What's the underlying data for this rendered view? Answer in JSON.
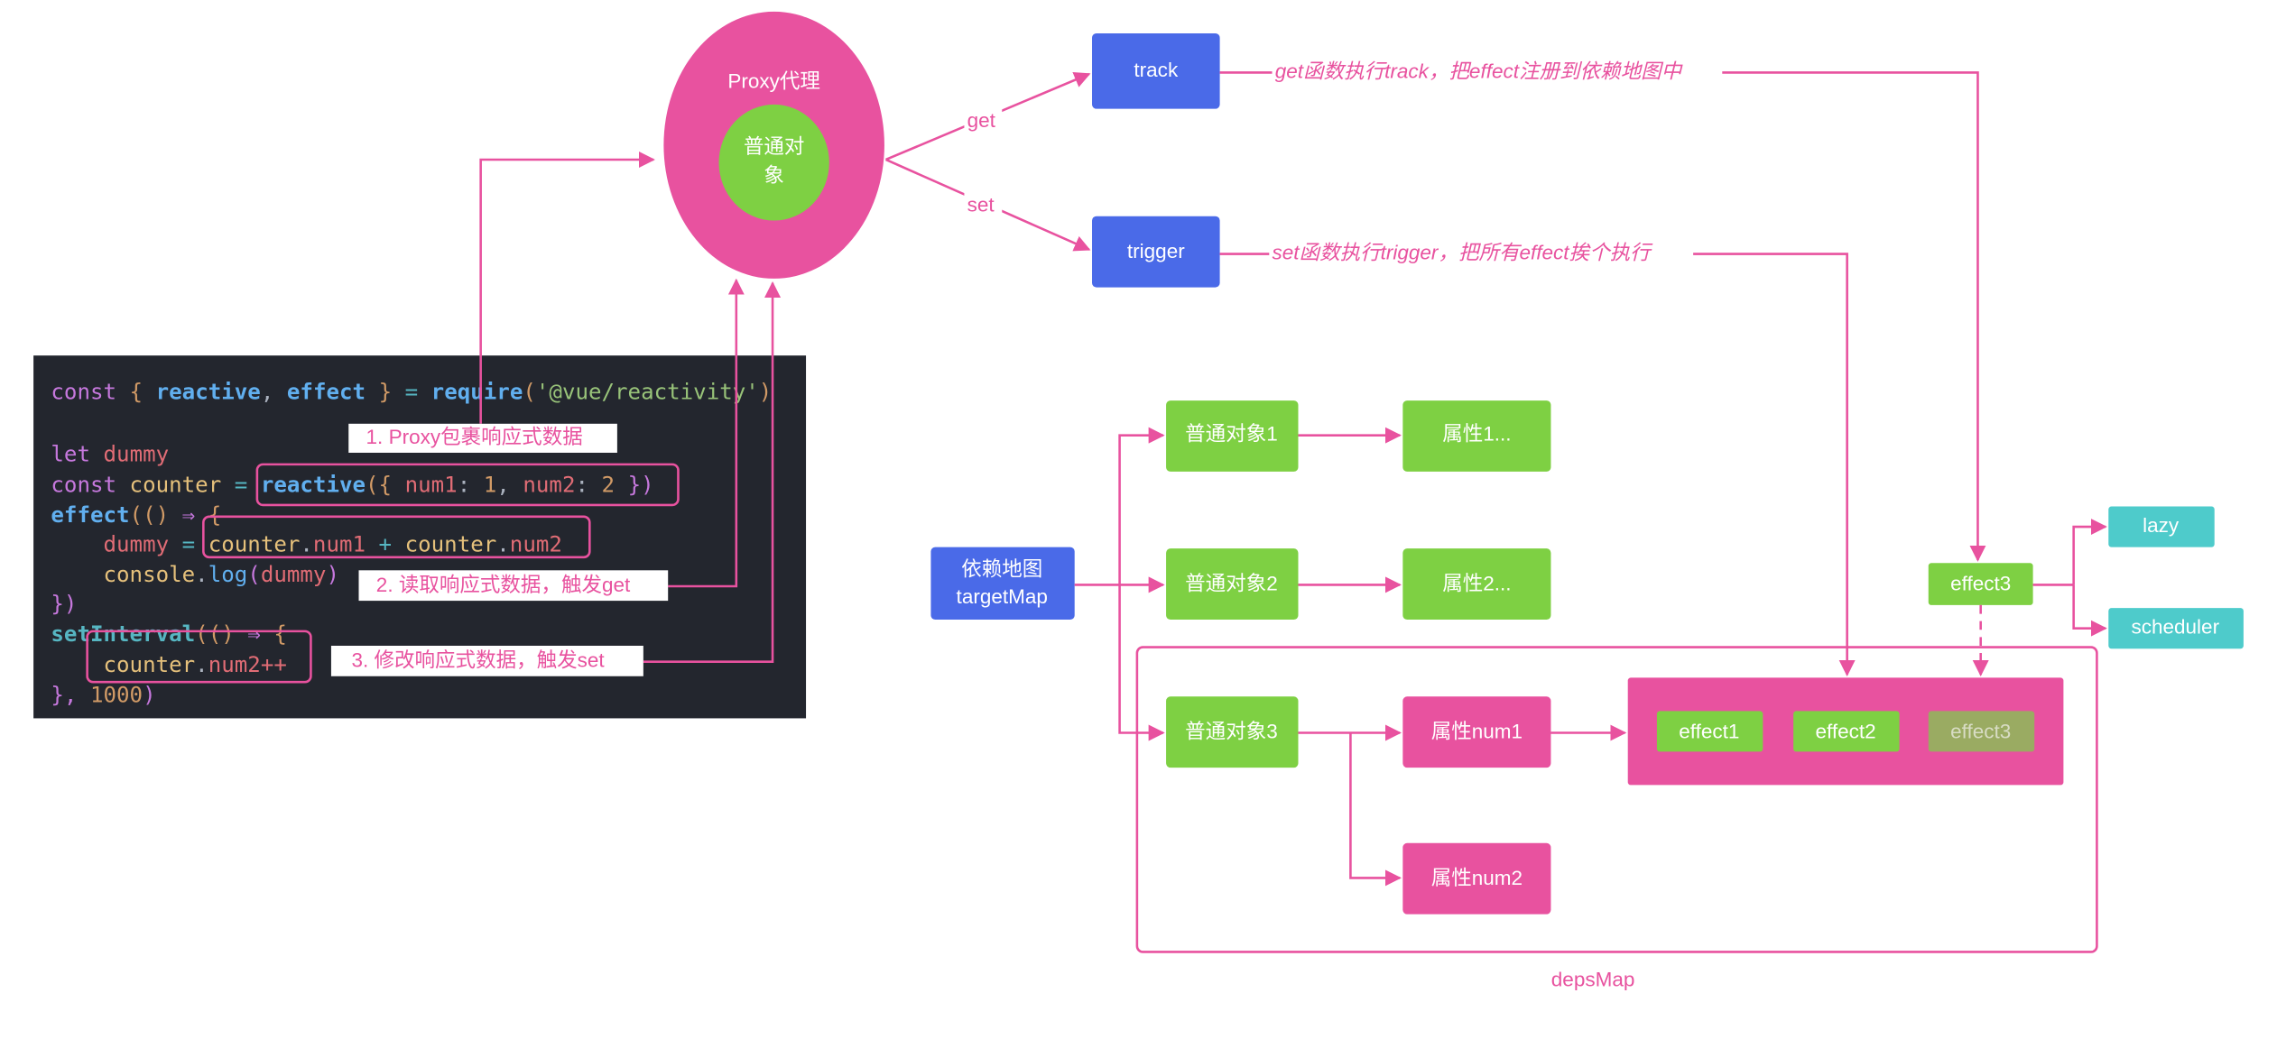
{
  "colors": {
    "pink": "#e8529f",
    "green": "#7ed043",
    "blue": "#4a6ae8",
    "teal": "#4ecbcb",
    "faded_green": "#9aab62",
    "code_bg": "#23262e"
  },
  "proxy": {
    "label": "Proxy代理",
    "inner_line1": "普通对",
    "inner_line2": "象",
    "get_label": "get",
    "set_label": "set"
  },
  "track": {
    "label": "track",
    "note": "get函数执行track，把effect注册到依赖地图中"
  },
  "trigger": {
    "label": "trigger",
    "note": "set函数执行trigger，把所有effect挨个执行"
  },
  "steps": [
    "1. Proxy包裹响应式数据",
    "2. 读取响应式数据，触发get",
    "3. 修改响应式数据，触发set"
  ],
  "code_lines": [
    [
      [
        "const ",
        "#c678dd"
      ],
      [
        "{ ",
        "#d19a66"
      ],
      [
        "reactive",
        "#61afef",
        1
      ],
      [
        ", ",
        "#abb2bf"
      ],
      [
        "effect",
        "#61afef",
        1
      ],
      [
        " } ",
        "#d19a66"
      ],
      [
        "= ",
        "#56b6c2"
      ],
      [
        "require",
        "#61afef",
        1
      ],
      [
        "(",
        "#d19a66"
      ],
      [
        "'@vue/reactivity'",
        "#98c379"
      ],
      [
        ")",
        "#d19a66"
      ]
    ],
    [],
    [
      [
        "let ",
        "#c678dd"
      ],
      [
        "dummy",
        "#e06c75"
      ]
    ],
    [
      [
        "const ",
        "#c678dd"
      ],
      [
        "counter ",
        "#e5c07b"
      ],
      [
        "= ",
        "#56b6c2"
      ],
      [
        "reactive",
        "#61afef",
        1
      ],
      [
        "({ ",
        "#d19a66"
      ],
      [
        "num1",
        "#e06c75"
      ],
      [
        ": ",
        "#abb2bf"
      ],
      [
        "1",
        "#d19a66"
      ],
      [
        ", ",
        "#abb2bf"
      ],
      [
        "num2",
        "#e06c75"
      ],
      [
        ": ",
        "#abb2bf"
      ],
      [
        "2",
        "#d19a66"
      ],
      [
        " })",
        "#c678dd"
      ]
    ],
    [
      [
        "effect",
        "#61afef",
        1
      ],
      [
        "(() ",
        "#d19a66"
      ],
      [
        "⇒ ",
        "#c678dd"
      ],
      [
        "{",
        "#d19a66"
      ]
    ],
    [
      [
        "    dummy ",
        "#e06c75"
      ],
      [
        "= ",
        "#56b6c2"
      ],
      [
        "counter",
        "#e5c07b"
      ],
      [
        ".",
        "#abb2bf"
      ],
      [
        "num1 ",
        "#e06c75"
      ],
      [
        "+ ",
        "#56b6c2"
      ],
      [
        "counter",
        "#e5c07b"
      ],
      [
        ".",
        "#abb2bf"
      ],
      [
        "num2",
        "#e06c75"
      ]
    ],
    [
      [
        "    console",
        "#e5c07b"
      ],
      [
        ".",
        "#abb2bf"
      ],
      [
        "log",
        "#61afef"
      ],
      [
        "(",
        "#c678dd"
      ],
      [
        "dummy",
        "#e06c75"
      ],
      [
        ")",
        "#c678dd"
      ]
    ],
    [
      [
        "})",
        "#c678dd"
      ]
    ],
    [
      [
        "setInterval",
        "#56b6c2",
        1
      ],
      [
        "(() ",
        "#d19a66"
      ],
      [
        "⇒ ",
        "#c678dd"
      ],
      [
        "{",
        "#d19a66"
      ]
    ],
    [
      [
        "    counter",
        "#e5c07b"
      ],
      [
        ".",
        "#abb2bf"
      ],
      [
        "num2++",
        "#e06c75"
      ]
    ],
    [
      [
        "}, ",
        "#c678dd"
      ],
      [
        "1000",
        "#d19a66"
      ],
      [
        ")",
        "#c678dd"
      ]
    ]
  ],
  "target_map": {
    "line1": "依赖地图",
    "line2": "targetMap"
  },
  "objects": [
    "普通对象1",
    "普通对象2",
    "普通对象3"
  ],
  "props": [
    "属性1...",
    "属性2...",
    "属性num1",
    "属性num2"
  ],
  "effects": [
    "effect1",
    "effect2",
    "effect3"
  ],
  "effect3_standalone": "effect3",
  "options": [
    "lazy",
    "scheduler"
  ],
  "deps_map_label": "depsMap"
}
